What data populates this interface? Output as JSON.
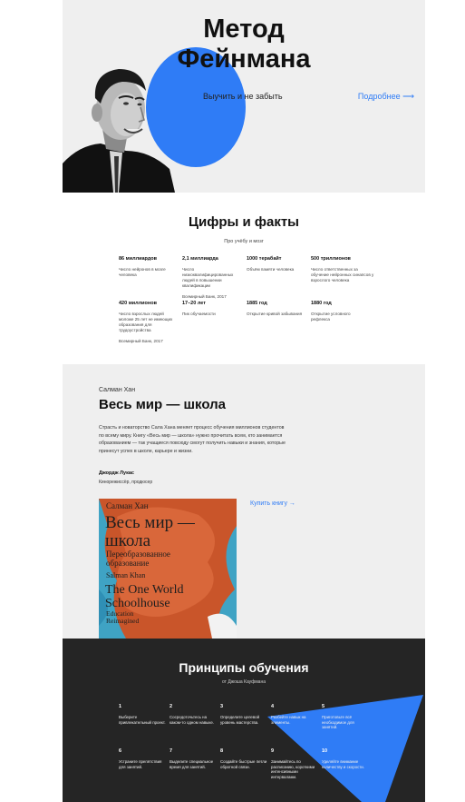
{
  "colors": {
    "accent": "#2f7cf6",
    "hero_bg": "#efefef",
    "dark_bg": "#252525"
  },
  "hero": {
    "title_line1": "Метод",
    "title_line2": "Фейнмана",
    "subtitle": "Выучить и не забыть",
    "more_link": "Подробнее ⟶"
  },
  "facts": {
    "title": "Цифры и факты",
    "lead": "Про учёбу и мозг",
    "items": [
      {
        "value": "86 миллиардов",
        "desc": "Число нейронов в мозге человека",
        "source": ""
      },
      {
        "value": "2,1 миллиарда",
        "desc": "Число низкоквалифицированных людей в повышении квалификации",
        "source": "Всемирный Банк, 2017"
      },
      {
        "value": "1000 терабайт",
        "desc": "Объём памяти человека",
        "source": ""
      },
      {
        "value": "500 триллионов",
        "desc": "Число ответственных за обучение нейронных синапсов у взрослого человека",
        "source": ""
      },
      {
        "value": "420 миллионов",
        "desc": "Число взрослых людей моложе 25 лет не имеющих образования для трудоустройства",
        "source": "Всемирный Банк, 2017"
      },
      {
        "value": "17–20 лет",
        "desc": "Пик обучаемости",
        "source": ""
      },
      {
        "value": "1885 год",
        "desc": "Открытие кривой забывания",
        "source": ""
      },
      {
        "value": "1880 год",
        "desc": "Открытие условного рефлекса",
        "source": ""
      }
    ]
  },
  "book": {
    "author": "Салман Хан",
    "title": "Весь мир — школа",
    "description": "Страсть и новаторство Сала Хана меняет процесс обучения миллионов студентов по всему миру. Книгу «Весь мир — школа» нужно прочитать всем, кто занимается образованием — так учащиеся повсюду смогут получить навыки и знания, которые принесут успех в школе, карьере и жизни.",
    "quote_author": "Джордж Лукас",
    "quote_role": "Кинорежиссёр, продюсер",
    "buy_link": "Купить книгу →",
    "cover": {
      "author_ru": "Салман Хан",
      "title_ru_1": "Весь мир —",
      "title_ru_2": "школа",
      "subtitle_ru_1": "Переобразованное",
      "subtitle_ru_2": "образование",
      "author_en": "Salman Khan",
      "title_en_1": "The One World",
      "title_en_2": "Schoolhouse",
      "subtitle_en_1": "Education",
      "subtitle_en_2": "Reimagined"
    }
  },
  "principles": {
    "title": "Принципы обучения",
    "by": "от Джоша Кауфмана",
    "items": [
      {
        "num": "1",
        "text": "Выберите привлекательный проект."
      },
      {
        "num": "2",
        "text": "Сосредоточьтесь на каком-то одном навыке."
      },
      {
        "num": "3",
        "text": "Определите целевой уровень мастерства."
      },
      {
        "num": "4",
        "text": "Разбейте навык на элементы."
      },
      {
        "num": "5",
        "text": "Приготовьте всё необходимое для занятий."
      },
      {
        "num": "6",
        "text": "Устраните препятствия для занятий."
      },
      {
        "num": "7",
        "text": "Выделите специальное время для занятий."
      },
      {
        "num": "8",
        "text": "Создайте быстрые петли обратной связи."
      },
      {
        "num": "9",
        "text": "Занимайтесь по расписанию, короткими интенсивными интервалами."
      },
      {
        "num": "10",
        "text": "Уделяйте внимание количеству и скорости."
      }
    ]
  }
}
